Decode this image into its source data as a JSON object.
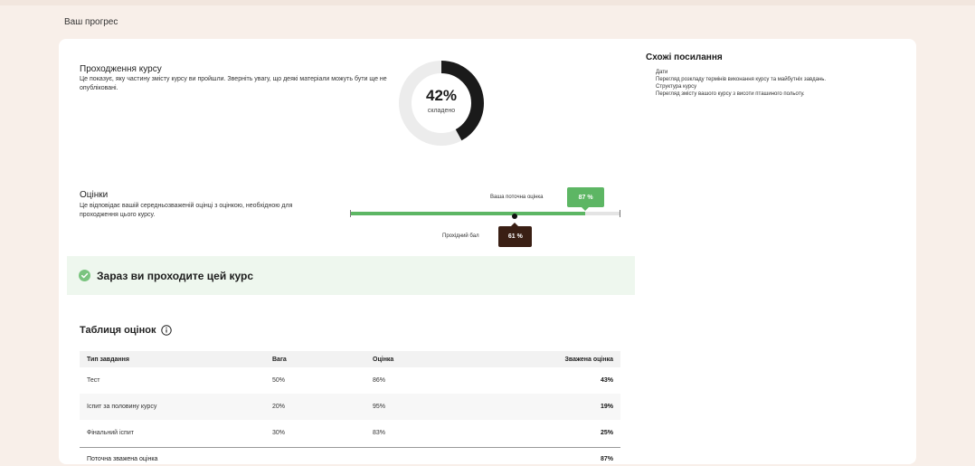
{
  "page": {
    "title": "Ваш прогрес"
  },
  "progress": {
    "title": "Проходження курсу",
    "description": "Це показує, яку частину змісту курсу ви пройшли. Зверніть увагу, що деякі матеріали можуть бути ще не опубліковані.",
    "percent": 42,
    "percent_text": "42%",
    "completed_label": "складено",
    "colors": {
      "complete": "#1a1a1a",
      "remaining": "#ececec"
    }
  },
  "grades": {
    "title": "Оцінки",
    "description": "Це відповідає вашій середньозваженій оцінці з оцінкою, необхідною для проходження цього курсу.",
    "current_label": "Ваша поточна оцінка",
    "current_value": "87 %",
    "current_fraction": 0.87,
    "passing_label": "Прохідний бал",
    "passing_value": "61 %",
    "passing_fraction": 0.61,
    "colors": {
      "current": "#5db664",
      "passing": "#3a1f14"
    }
  },
  "status": {
    "text": "Зараз ви проходите цей курс",
    "icon": "check-circle-icon",
    "color": "#7ac47f"
  },
  "grade_table": {
    "title": "Таблиця оцінок",
    "info_icon": "info-icon",
    "headers": {
      "type": "Тип завдання",
      "weight": "Вага",
      "grade": "Оцінка",
      "weighted": "Зважена оцінка"
    },
    "rows": [
      {
        "type": "Тест",
        "weight": "50%",
        "grade": "86%",
        "weighted": "43%"
      },
      {
        "type": "Іспит за половину курсу",
        "weight": "20%",
        "grade": "95%",
        "weighted": "19%"
      },
      {
        "type": "Фінальний іспит",
        "weight": "30%",
        "grade": "83%",
        "weighted": "25%"
      }
    ],
    "total": {
      "label": "Поточна зважена оцінка",
      "value": "87%"
    }
  },
  "related": {
    "title": "Схожі посилання",
    "links": [
      "Дати",
      "Перегляд розкладу термінів виконання курсу та майбутніх завдань.",
      "Структура курсу",
      "Перегляд змісту вашого курсу з висоти пташиного польоту."
    ]
  }
}
